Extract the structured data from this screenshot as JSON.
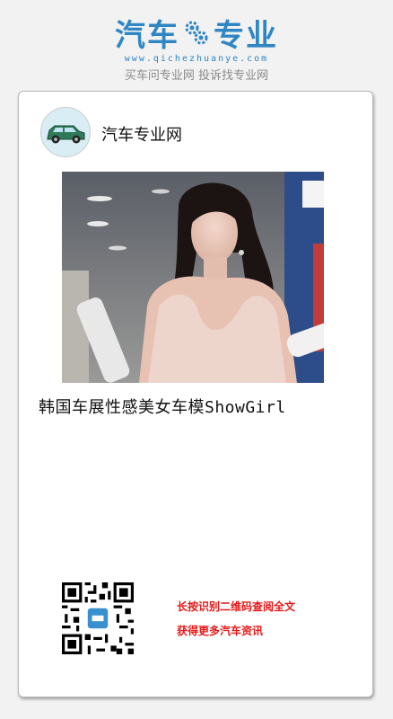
{
  "brand": {
    "name_part1": "汽车",
    "name_part2": "专业",
    "url": "www.qichezhuanye.com",
    "slogan": "买车问专业网 投诉找专业网",
    "color": "#2f86c5"
  },
  "card": {
    "site_name": "汽车专业网",
    "avatar_icon": "car-icon",
    "photo_icon": "photo-image",
    "article_title": "韩国车展性感美女车模ShowGirl",
    "qr_icon": "qr-code-icon",
    "qr_line1": "长按识别二维码查阅全文",
    "qr_line2": "获得更多汽车资讯",
    "accent_color": "#e51919"
  }
}
